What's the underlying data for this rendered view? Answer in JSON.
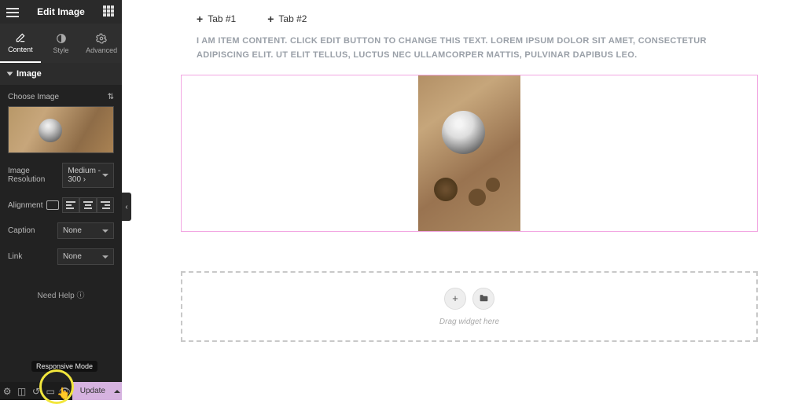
{
  "header": {
    "title": "Edit Image"
  },
  "panel_tabs": {
    "content": "Content",
    "style": "Style",
    "advanced": "Advanced"
  },
  "section": {
    "image_label": "Image"
  },
  "fields": {
    "choose_image": "Choose Image",
    "image_resolution_label": "Image Resolution",
    "image_resolution_value": "Medium - 300 ›",
    "alignment_label": "Alignment",
    "caption_label": "Caption",
    "caption_value": "None",
    "link_label": "Link",
    "link_value": "None"
  },
  "help": "Need Help",
  "tooltip_responsive": "Responsive Mode",
  "update_button": "Update",
  "page_tabs": {
    "tab1": "Tab #1",
    "tab2": "Tab #2"
  },
  "page_text": "I AM ITEM CONTENT. CLICK EDIT BUTTON TO CHANGE THIS TEXT. LOREM IPSUM DOLOR SIT AMET, CONSECTETUR ADIPISCING ELIT. UT ELIT TELLUS, LUCTUS NEC ULLAMCORPER MATTIS, PULVINAR DAPIBUS LEO.",
  "dropzone": {
    "label": "Drag widget here"
  }
}
